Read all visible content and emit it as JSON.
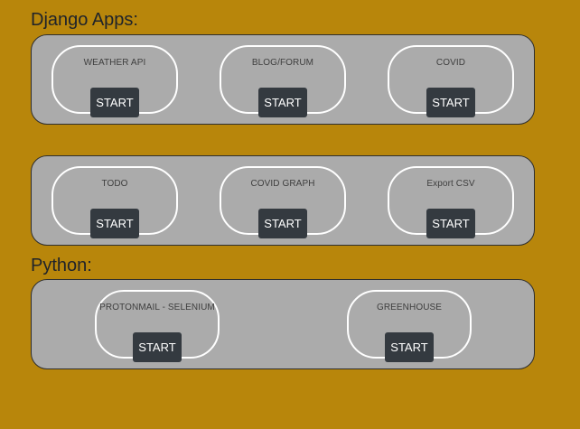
{
  "sections": {
    "django_title": "Django Apps:",
    "python_title": "Python:"
  },
  "django_row1": [
    {
      "label": "WEATHER API",
      "button": "START"
    },
    {
      "label": "BLOG/FORUM",
      "button": "START"
    },
    {
      "label": "COVID",
      "button": "START"
    }
  ],
  "django_row2": [
    {
      "label": "TODO",
      "button": "START"
    },
    {
      "label": "COVID GRAPH",
      "button": "START"
    },
    {
      "label": "Export CSV",
      "button": "START"
    }
  ],
  "python_row": [
    {
      "label": "PROTONMAIL - SELENIUM",
      "button": "START"
    },
    {
      "label": "GREENHOUSE",
      "button": "START"
    }
  ],
  "colors": {
    "background": "#b8860b",
    "panel": "#ababab",
    "button": "#343a40",
    "card_border": "#ffffff"
  }
}
